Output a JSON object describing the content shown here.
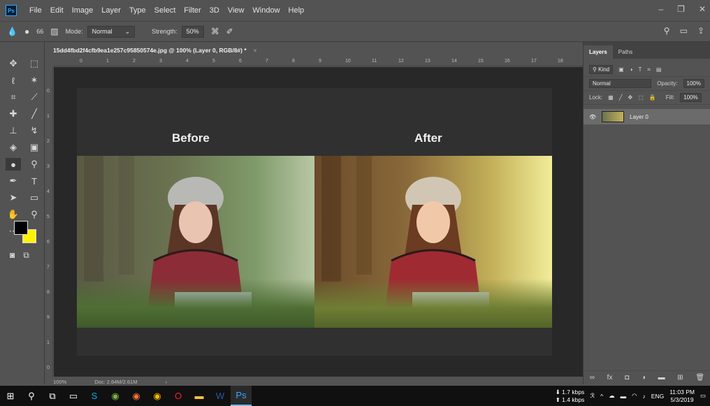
{
  "menubar": {
    "logo": "Ps",
    "items": [
      "File",
      "Edit",
      "Image",
      "Layer",
      "Type",
      "Select",
      "Filter",
      "3D",
      "View",
      "Window",
      "Help"
    ]
  },
  "options": {
    "brush_size": "66",
    "mode_label": "Mode:",
    "mode_value": "Normal",
    "strength_label": "Strength:",
    "strength_value": "50%"
  },
  "document": {
    "tab_title": "15dd4fbd2f4cfb9ea1e257c95850574e.jpg @ 100% (Layer 0, RGB/8#) *",
    "close": "×",
    "ruler_top": [
      "0",
      "1",
      "2",
      "3",
      "4",
      "5",
      "6",
      "7",
      "8",
      "9",
      "10",
      "11",
      "12",
      "13",
      "14",
      "15",
      "16",
      "17",
      "18"
    ],
    "ruler_left": [
      "0",
      "1",
      "2",
      "3",
      "4",
      "5",
      "6",
      "7",
      "8",
      "9",
      "1",
      "0"
    ],
    "canvas": {
      "before_label": "Before",
      "after_label": "After"
    },
    "status": {
      "zoom": "100%",
      "doc": "Doc: 2.64M/2.61M"
    }
  },
  "panel": {
    "tabs": [
      "Layers",
      "Paths"
    ],
    "kind_label": "Kind",
    "blend_mode": "Normal",
    "opacity_label": "Opacity:",
    "opacity_value": "100%",
    "lock_label": "Lock:",
    "fill_label": "Fill:",
    "fill_value": "100%",
    "layer_name": "Layer 0"
  },
  "taskbar": {
    "down_speed": "1.7 kbps",
    "up_speed": "1.4 kbps",
    "lang": "ENG",
    "time": "11:03 PM",
    "date": "5/3/2019"
  },
  "colors": {
    "foreground": "#000000",
    "background": "#fff200",
    "accent": "#31a8ff"
  }
}
